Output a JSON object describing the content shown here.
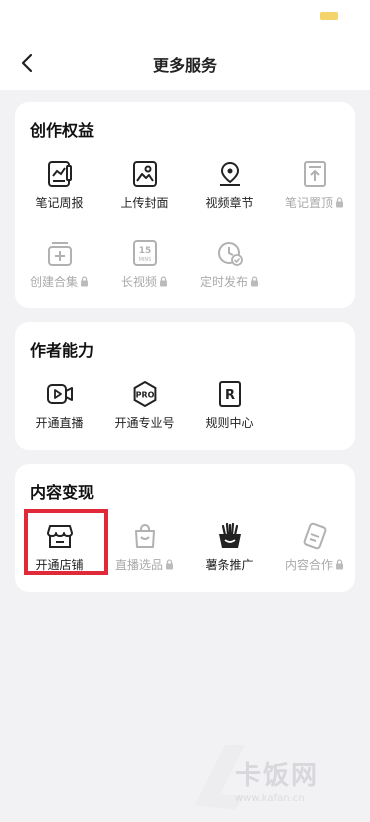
{
  "header": {
    "title": "更多服务"
  },
  "sections": [
    {
      "title": "创作权益",
      "items": [
        {
          "label": "笔记周报",
          "icon": "report-icon",
          "locked": false
        },
        {
          "label": "上传封面",
          "icon": "image-icon",
          "locked": false
        },
        {
          "label": "视频章节",
          "icon": "chapter-icon",
          "locked": false
        },
        {
          "label": "笔记置顶",
          "icon": "pin-top-icon",
          "locked": true
        },
        {
          "label": "创建合集",
          "icon": "collection-icon",
          "locked": true
        },
        {
          "label": "长视频",
          "icon": "long-video-icon",
          "locked": true
        },
        {
          "label": "定时发布",
          "icon": "schedule-icon",
          "locked": true
        }
      ]
    },
    {
      "title": "作者能力",
      "items": [
        {
          "label": "开通直播",
          "icon": "live-icon",
          "locked": false
        },
        {
          "label": "开通专业号",
          "icon": "pro-icon",
          "locked": false
        },
        {
          "label": "规则中心",
          "icon": "rules-icon",
          "locked": false
        }
      ]
    },
    {
      "title": "内容变现",
      "items": [
        {
          "label": "开通店铺",
          "icon": "store-icon",
          "locked": false
        },
        {
          "label": "直播选品",
          "icon": "shopping-bag-icon",
          "locked": true
        },
        {
          "label": "薯条推广",
          "icon": "fries-icon",
          "locked": false
        },
        {
          "label": "内容合作",
          "icon": "cooperation-icon",
          "locked": true
        }
      ]
    }
  ],
  "icon_text": {
    "mins_number": "15",
    "mins_unit": "MINS",
    "pro": "PRO",
    "rules": "R"
  },
  "watermark": {
    "brand": "卡饭网",
    "url": "www.kafan.cn"
  },
  "colors": {
    "highlight": "#e02a3a",
    "background": "#f2f2f4",
    "disabled": "#aaaaaa"
  }
}
